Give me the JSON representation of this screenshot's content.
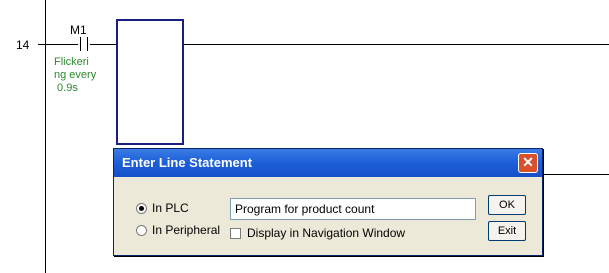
{
  "ladder": {
    "rung_number": "14",
    "contact_label": "M1",
    "comment_lines": [
      "Flickeri",
      "ng every",
      " 0.9s"
    ]
  },
  "dialog": {
    "title": "Enter Line Statement",
    "close_glyph": "✕",
    "radio_plc_label": "In PLC",
    "radio_peripheral_label": "In Peripheral",
    "selected_option": "In PLC",
    "statement_value": "Program for product count",
    "checkbox_label": "Display in Navigation Window",
    "checkbox_checked": false,
    "ok_label": "OK",
    "exit_label": "Exit"
  },
  "colors": {
    "comment_text": "#2e8b2e",
    "title_bar": "#1d5fd8",
    "close_button": "#d9512c",
    "cursor_box": "#1a2080"
  }
}
